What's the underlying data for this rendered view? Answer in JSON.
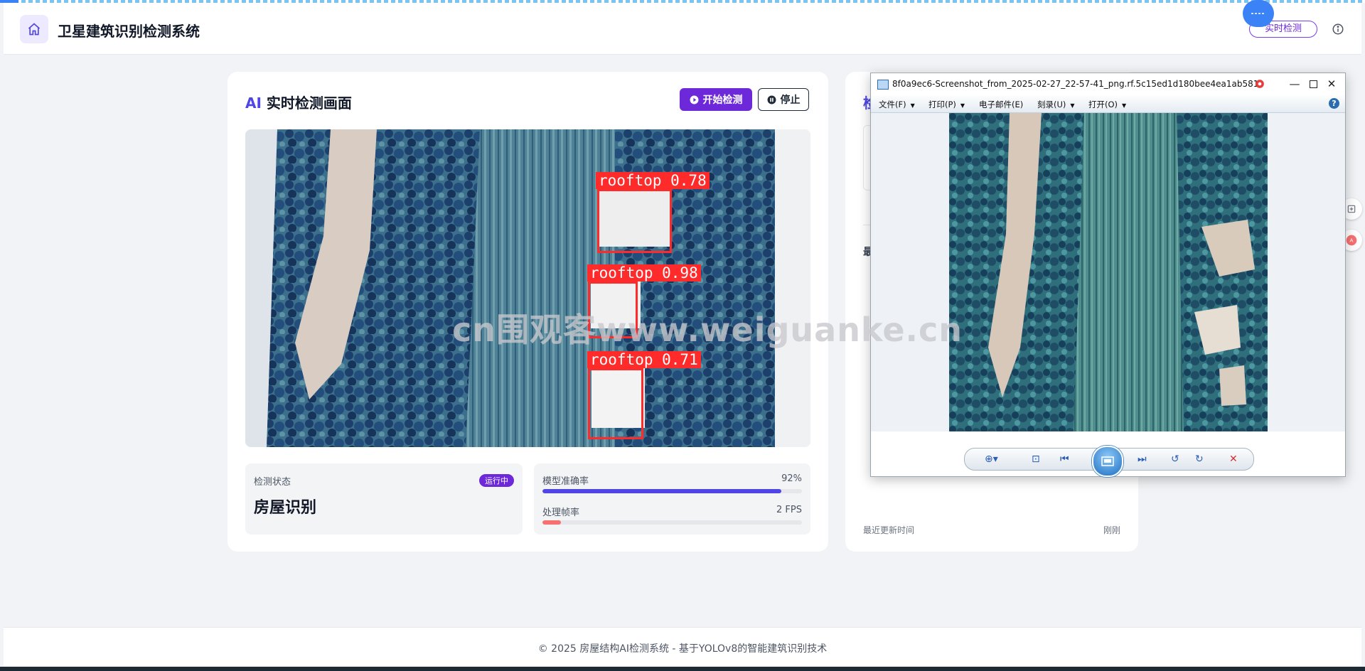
{
  "app": {
    "title": "卫星建筑识别检测系统",
    "header_pill": "实时检测"
  },
  "detection_panel": {
    "title_prefix": "AI",
    "title_rest": " 实时检测画面",
    "start_button": "开始检测",
    "stop_button": "停止",
    "detections": [
      {
        "label": "rooftop 0.78"
      },
      {
        "label": "rooftop 0.98"
      },
      {
        "label": "rooftop 0.71"
      }
    ],
    "status": {
      "label": "检测状态",
      "badge": "运行中",
      "value": "房屋识别"
    },
    "metrics": [
      {
        "label": "模型准确率",
        "value_text": "92%",
        "progress": 0.92,
        "color": "#4f46e5"
      },
      {
        "label": "处理帧率",
        "value_text": "2 FPS",
        "progress": 0.07,
        "color": "#f87171"
      }
    ]
  },
  "right_panel": {
    "title_partial": "检",
    "subtitle_partial": "最",
    "last_update_label": "最近更新时间",
    "last_update_value": "刚刚"
  },
  "viewer": {
    "title": "8f0a9ec6-Screenshot_from_2025-02-27_22-57-41_png.rf.5c15ed1d180bee4ea1ab581...",
    "menus": [
      "文件(F)",
      "打印(P)",
      "电子邮件(E)",
      "刻录(U)",
      "打开(O)"
    ],
    "help": "?"
  },
  "watermark": "cn围观客www.weiguanke.cn",
  "footer": {
    "text": "© 2025 房屋结构AI检测系统 - 基于YOLOv8的智能建筑识别技术"
  },
  "colors": {
    "accent": "#6d28d9",
    "brand_blue": "#4f46e5",
    "box_red": "#ff2a2a"
  }
}
